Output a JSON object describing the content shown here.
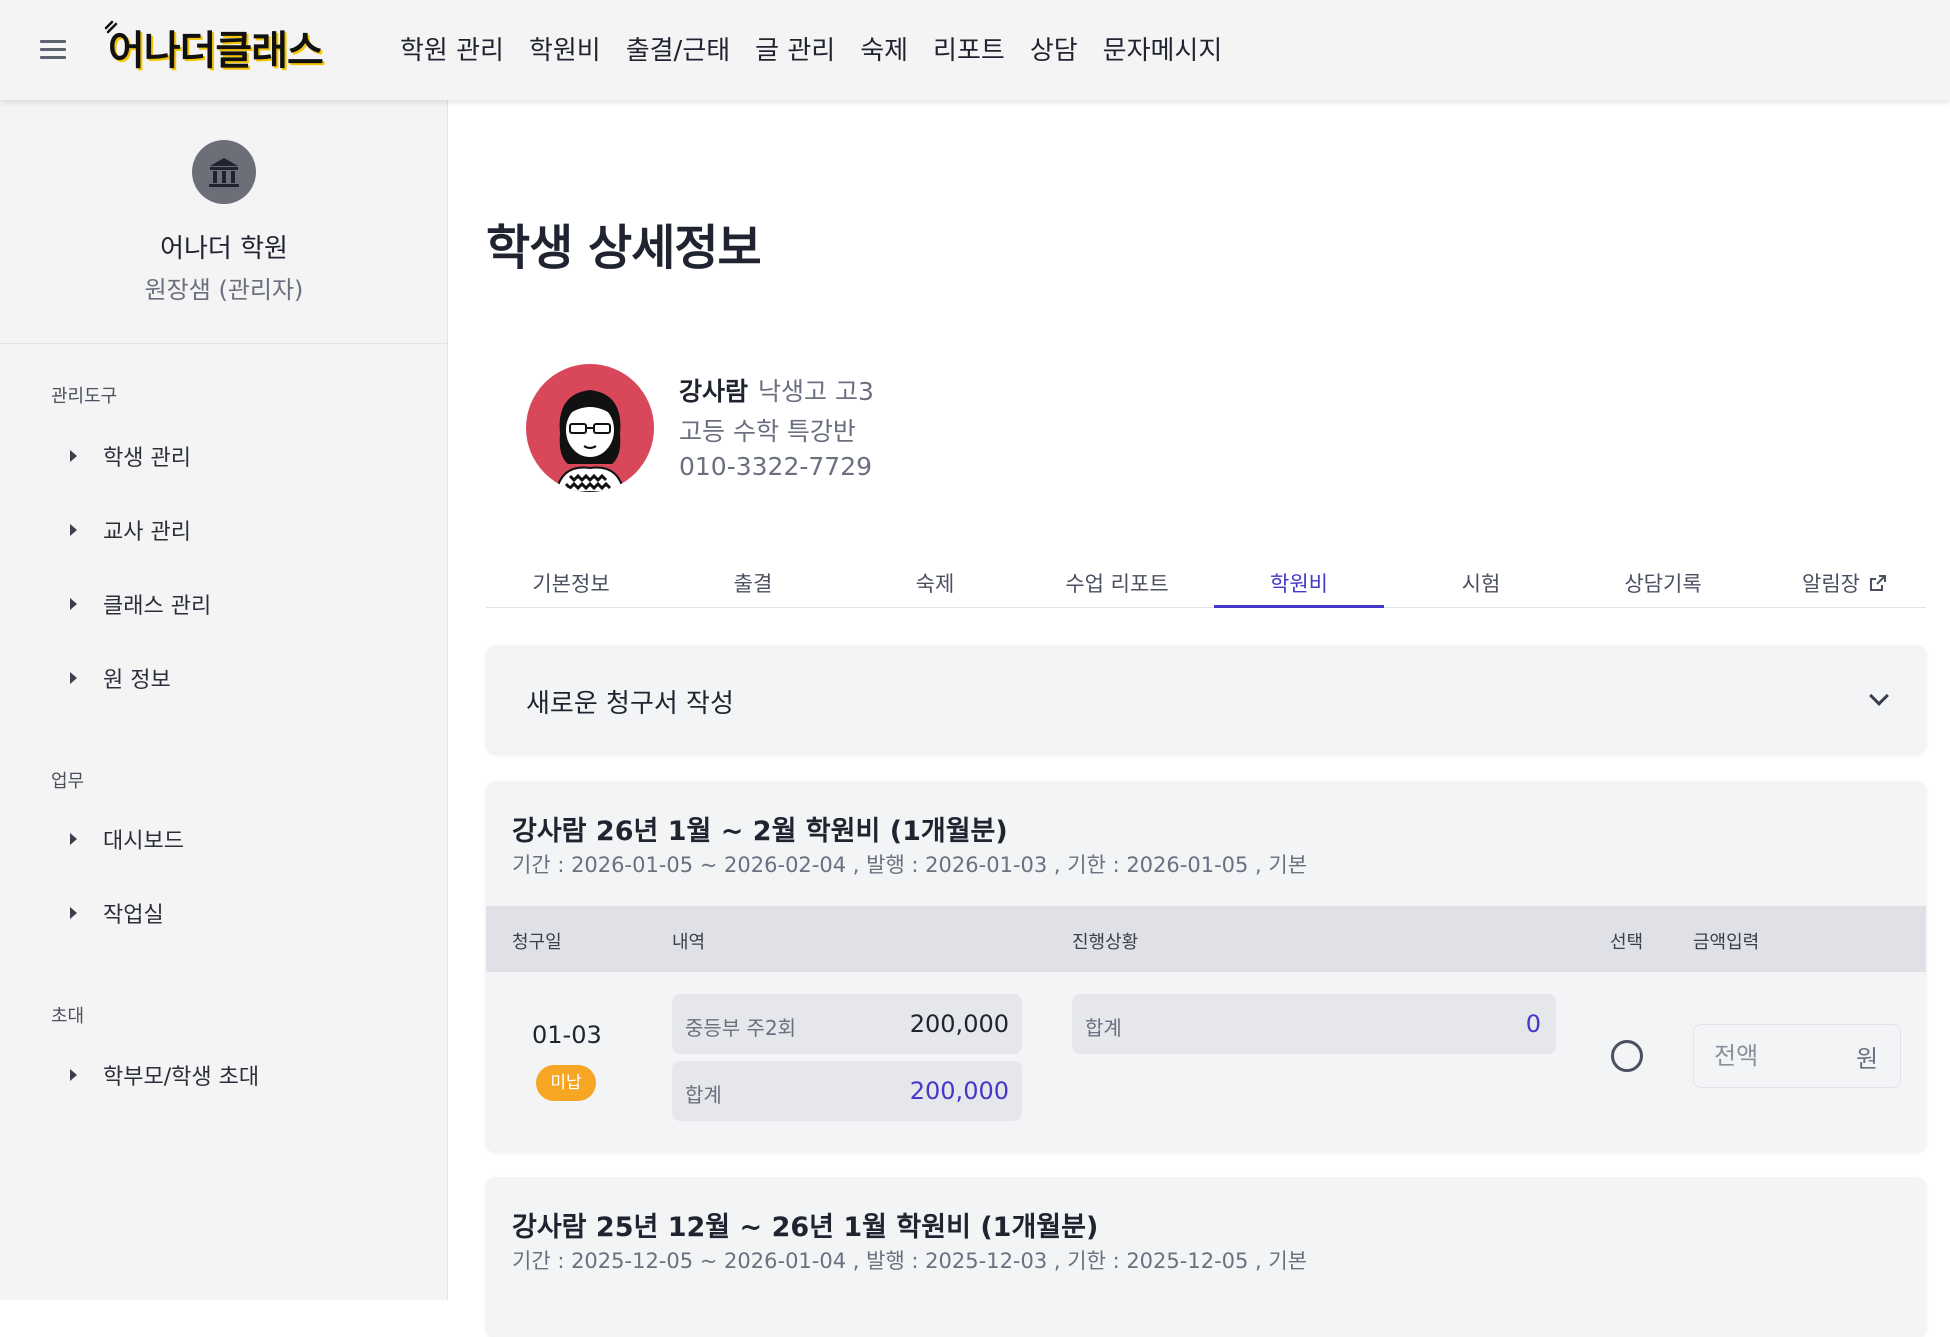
{
  "app": {
    "logo_text": "어나더클래스",
    "top_nav": [
      "학원 관리",
      "학원비",
      "출결/근태",
      "글 관리",
      "숙제",
      "리포트",
      "상담",
      "문자메시지"
    ]
  },
  "sidebar": {
    "org_name": "어나더 학원",
    "org_role": "원장샘 (관리자)",
    "sections": [
      {
        "title": "관리도구",
        "items": [
          "학생 관리",
          "교사 관리",
          "클래스 관리",
          "원 정보"
        ]
      },
      {
        "title": "업무",
        "items": [
          "대시보드",
          "작업실"
        ]
      },
      {
        "title": "초대",
        "items": [
          "학부모/학생 초대"
        ]
      }
    ]
  },
  "page": {
    "title": "학생 상세정보"
  },
  "student": {
    "name": "강사람",
    "school": "낙생고 고3",
    "class": "고등 수학 특강반",
    "phone": "010-3322-7729"
  },
  "tabs": [
    "기본정보",
    "출결",
    "숙제",
    "수업 리포트",
    "학원비",
    "시험",
    "상담기록",
    "알림장"
  ],
  "active_tab": "학원비",
  "new_invoice": {
    "label": "새로운 청구서 작성"
  },
  "invoices": [
    {
      "title": "강사람 26년 1월 ~ 2월 학원비 (1개월분)",
      "meta": "기간 : 2026-01-05 ~ 2026-02-04 , 발행 : 2026-01-03 , 기한 : 2026-01-05 , 기본",
      "columns": [
        "청구일",
        "내역",
        "진행상황",
        "선택",
        "금액입력"
      ],
      "row": {
        "date": "01-03",
        "status_badge": "미납",
        "items": [
          {
            "label": "중등부 주2회",
            "amount": "200,000"
          },
          {
            "label": "합계",
            "amount": "200,000"
          }
        ],
        "progress": {
          "label": "합계",
          "amount": "0"
        },
        "amount_placeholder": "전액",
        "unit": "원"
      }
    },
    {
      "title": "강사람 25년 12월 ~ 26년 1월 학원비 (1개월분)",
      "meta": "기간 : 2025-12-05 ~ 2026-01-04 , 발행 : 2025-12-03 , 기한 : 2025-12-05 , 기본"
    }
  ],
  "colors": {
    "accent": "#4338ca",
    "badge_unpaid": "#f6a623",
    "avatar_bg": "#d9485a",
    "sidebar_bg": "#f4f4f5"
  },
  "icons": [
    "hamburger-icon",
    "institution-icon",
    "caret-right-icon",
    "external-link-icon",
    "chevron-down-icon",
    "radio-icon"
  ]
}
